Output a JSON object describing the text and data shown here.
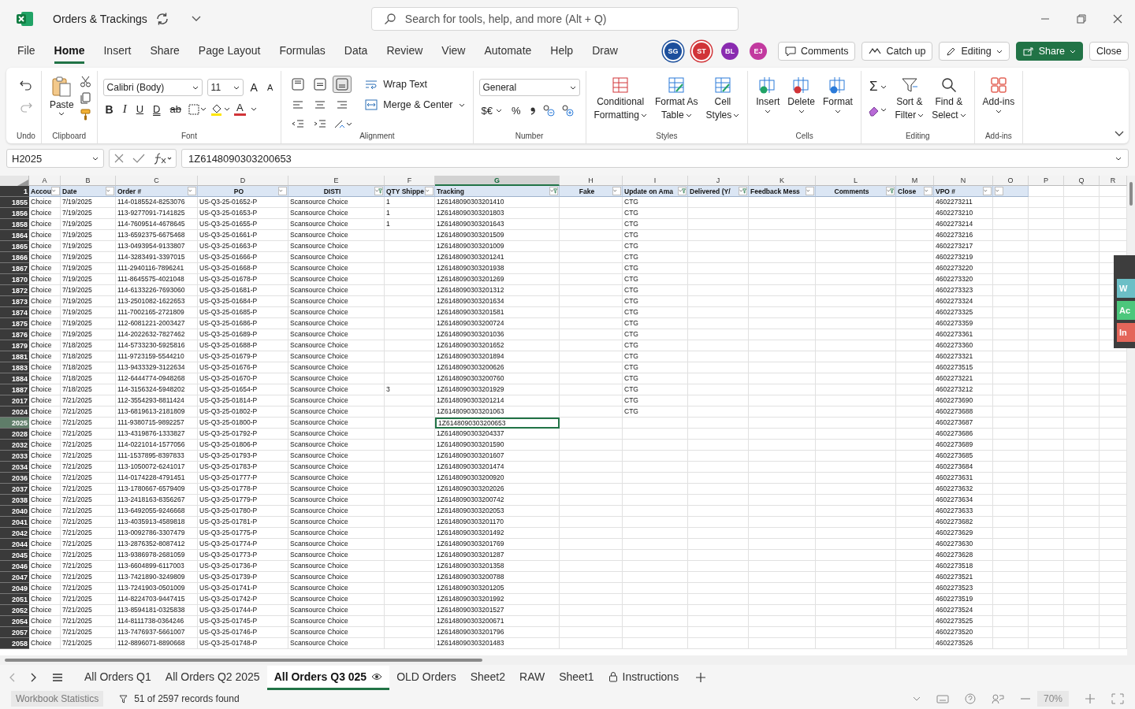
{
  "window": {
    "title": "Orders & Trackings"
  },
  "search": {
    "placeholder": "Search for tools, help, and more (Alt + Q)"
  },
  "menu": [
    {
      "label": "File",
      "selected": false
    },
    {
      "label": "Home",
      "selected": true
    },
    {
      "label": "Insert",
      "selected": false
    },
    {
      "label": "Share",
      "selected": false
    },
    {
      "label": "Page Layout",
      "selected": false
    },
    {
      "label": "Formulas",
      "selected": false
    },
    {
      "label": "Data",
      "selected": false
    },
    {
      "label": "Review",
      "selected": false
    },
    {
      "label": "View",
      "selected": false
    },
    {
      "label": "Automate",
      "selected": false
    },
    {
      "label": "Help",
      "selected": false
    },
    {
      "label": "Draw",
      "selected": false
    }
  ],
  "collaborators": [
    {
      "initials": "SG",
      "color": "#1c4f9c",
      "active": true
    },
    {
      "initials": "ST",
      "color": "#d13438",
      "active": true
    },
    {
      "initials": "BL",
      "color": "#8a2bb0",
      "active": false
    },
    {
      "initials": "EJ",
      "color": "#c2399f",
      "active": false
    }
  ],
  "actions": [
    {
      "label": "Comments",
      "kind": "comments"
    },
    {
      "label": "Catch up",
      "kind": "catchup"
    },
    {
      "label": "Editing",
      "kind": "editing"
    },
    {
      "label": "Share",
      "kind": "share"
    },
    {
      "label": "Close",
      "kind": "plain"
    }
  ],
  "ribbon": [
    {
      "kind": "undo",
      "label": "Undo"
    },
    {
      "kind": "clipboard",
      "label": "Clipboard",
      "paste": "Paste"
    },
    {
      "kind": "font",
      "label": "Font",
      "font": "Calibri (Body)",
      "size": "11",
      "grow": "A",
      "shrink": "A",
      "styles": [
        "B",
        "I",
        "U",
        "D",
        "ab"
      ],
      "color_button": "A"
    },
    {
      "kind": "alignment",
      "label": "Alignment",
      "wrap": "Wrap Text",
      "merge": "Merge & Center"
    },
    {
      "kind": "number",
      "label": "Number",
      "format": "General",
      "currency": "$€",
      "percent": "%"
    },
    {
      "kind": "styles",
      "label": "Styles",
      "buttons": [
        {
          "lines": [
            "Conditional",
            "Formatting"
          ]
        },
        {
          "lines": [
            "Format As",
            "Table"
          ]
        },
        {
          "lines": [
            "Cell",
            "Styles"
          ]
        }
      ]
    },
    {
      "kind": "cells",
      "label": "Cells",
      "buttons": [
        {
          "lines": [
            "Insert"
          ]
        },
        {
          "lines": [
            "Delete"
          ]
        },
        {
          "lines": [
            "Format"
          ]
        }
      ]
    },
    {
      "kind": "editing",
      "label": "Editing",
      "sum": "Σ",
      "buttons": [
        {
          "lines": [
            "Sort &",
            "Filter"
          ]
        },
        {
          "lines": [
            "Find &",
            "Select"
          ]
        }
      ]
    },
    {
      "kind": "addins",
      "label": "Add-ins",
      "buttons": [
        {
          "lines": [
            "Add-ins"
          ]
        }
      ]
    }
  ],
  "formula_bar": {
    "name_box": "H2025",
    "formula": "1Z6148090303200653"
  },
  "columns": [
    {
      "letter": "A",
      "selected": false,
      "header": {
        "text": "Accou",
        "filtered": false
      }
    },
    {
      "letter": "B",
      "selected": false,
      "header": {
        "text": "Date",
        "filtered": false
      }
    },
    {
      "letter": "C",
      "selected": false,
      "header": {
        "text": "Order #",
        "filtered": false
      }
    },
    {
      "letter": "D",
      "selected": false,
      "header": {
        "text": "PO",
        "filtered": false
      }
    },
    {
      "letter": "E",
      "selected": false,
      "header": {
        "text": "DISTI",
        "filtered": true
      }
    },
    {
      "letter": "F",
      "selected": false,
      "header": {
        "text": "QTY Shippe",
        "filtered": false
      }
    },
    {
      "letter": "G",
      "selected": true,
      "header": {
        "text": "Tracking",
        "filtered": true
      }
    },
    {
      "letter": "H",
      "selected": false,
      "header": {
        "text": "Fake",
        "filtered": false
      }
    },
    {
      "letter": "I",
      "selected": false,
      "header": {
        "text": "Update on Ama",
        "filtered": true
      }
    },
    {
      "letter": "J",
      "selected": false,
      "header": {
        "text": "Delivered (Y/",
        "filtered": true
      }
    },
    {
      "letter": "K",
      "selected": false,
      "header": {
        "text": "Feedback Mess",
        "filtered": false
      }
    },
    {
      "letter": "L",
      "selected": false,
      "header": {
        "text": "Comments",
        "filtered": true
      }
    },
    {
      "letter": "M",
      "selected": false,
      "header": {
        "text": "Close",
        "filtered": false
      }
    },
    {
      "letter": "N",
      "selected": false,
      "header": {
        "text": "VPO #",
        "filtered": false
      }
    },
    {
      "letter": "O",
      "selected": false,
      "header": {
        "filtered": false
      }
    },
    {
      "letter": "P",
      "selected": false
    },
    {
      "letter": "Q",
      "selected": false
    },
    {
      "letter": "R",
      "selected": false
    }
  ],
  "header_row_number": "1",
  "rows": [
    {
      "number": "1855",
      "selected": false,
      "account": "Choice",
      "date": "7/19/2025",
      "order": "114-0185524-8253076",
      "po": "US-Q3-25-01652-P",
      "disti": "Scansource Choice",
      "qty": "1",
      "tracking": "1Z6148090303201410",
      "update": "CTG",
      "vpo": "4602273211"
    },
    {
      "number": "1856",
      "selected": false,
      "account": "Choice",
      "date": "7/19/2025",
      "order": "113-9277091-7141825",
      "po": "US-Q3-25-01653-P",
      "disti": "Scansource Choice",
      "qty": "1",
      "tracking": "1Z6148090303201803",
      "update": "CTG",
      "vpo": "4602273210"
    },
    {
      "number": "1858",
      "selected": false,
      "account": "Choice",
      "date": "7/19/2025",
      "order": "114-7609514-4678645",
      "po": "US-Q3-25-01655-P",
      "disti": "Scansource Choice",
      "qty": "1",
      "tracking": "1Z6148090303201643",
      "update": "CTG",
      "vpo": "4602273214"
    },
    {
      "number": "1864",
      "selected": false,
      "account": "Choice",
      "date": "7/19/2025",
      "order": "113-6592375-6675468",
      "po": "US-Q3-25-01661-P",
      "disti": "Scansource Choice",
      "tracking": "1Z6148090303201509",
      "update": "CTG",
      "vpo": "4602273216"
    },
    {
      "number": "1865",
      "selected": false,
      "account": "Choice",
      "date": "7/19/2025",
      "order": "113-0493954-9133807",
      "po": "US-Q3-25-01663-P",
      "disti": "Scansource Choice",
      "tracking": "1Z6148090303201009",
      "update": "CTG",
      "vpo": "4602273217"
    },
    {
      "number": "1866",
      "selected": false,
      "account": "Choice",
      "date": "7/19/2025",
      "order": "114-3283491-3397015",
      "po": "US-Q3-25-01666-P",
      "disti": "Scansource Choice",
      "tracking": "1Z6148090303201241",
      "update": "CTG",
      "vpo": "4602273219"
    },
    {
      "number": "1867",
      "selected": false,
      "account": "Choice",
      "date": "7/19/2025",
      "order": "111-2940116-7896241",
      "po": "US-Q3-25-01668-P",
      "disti": "Scansource Choice",
      "tracking": "1Z6148090303201938",
      "update": "CTG",
      "vpo": "4602273220"
    },
    {
      "number": "1870",
      "selected": false,
      "account": "Choice",
      "date": "7/19/2025",
      "order": "111-8645575-4021048",
      "po": "US-Q3-25-01678-P",
      "disti": "Scansource Choice",
      "tracking": "1Z6148090303201269",
      "update": "CTG",
      "vpo": "4602273320"
    },
    {
      "number": "1872",
      "selected": false,
      "account": "Choice",
      "date": "7/19/2025",
      "order": "114-6133226-7693060",
      "po": "US-Q3-25-01681-P",
      "disti": "Scansource Choice",
      "tracking": "1Z6148090303201312",
      "update": "CTG",
      "vpo": "4602273323"
    },
    {
      "number": "1873",
      "selected": false,
      "account": "Choice",
      "date": "7/19/2025",
      "order": "113-2501082-1622653",
      "po": "US-Q3-25-01684-P",
      "disti": "Scansource Choice",
      "tracking": "1Z6148090303201634",
      "update": "CTG",
      "vpo": "4602273324"
    },
    {
      "number": "1874",
      "selected": false,
      "account": "Choice",
      "date": "7/19/2025",
      "order": "111-7002165-2721809",
      "po": "US-Q3-25-01685-P",
      "disti": "Scansource Choice",
      "tracking": "1Z6148090303201581",
      "update": "CTG",
      "vpo": "4602273325"
    },
    {
      "number": "1875",
      "selected": false,
      "account": "Choice",
      "date": "7/19/2025",
      "order": "112-6081221-2003427",
      "po": "US-Q3-25-01686-P",
      "disti": "Scansource Choice",
      "tracking": "1Z6148090303200724",
      "update": "CTG",
      "vpo": "4602273359"
    },
    {
      "number": "1876",
      "selected": false,
      "account": "Choice",
      "date": "7/19/2025",
      "order": "114-2022632-7827462",
      "po": "US-Q3-25-01689-P",
      "disti": "Scansource Choice",
      "tracking": "1Z6148090303201036",
      "update": "CTG",
      "vpo": "4602273361"
    },
    {
      "number": "1879",
      "selected": false,
      "account": "Choice",
      "date": "7/18/2025",
      "order": "114-5733230-5925816",
      "po": "US-Q3-25-01688-P",
      "disti": "Scansource Choice",
      "tracking": "1Z6148090303201652",
      "update": "CTG",
      "vpo": "4602273360"
    },
    {
      "number": "1881",
      "selected": false,
      "account": "Choice",
      "date": "7/18/2025",
      "order": "111-9723159-5544210",
      "po": "US-Q3-25-01679-P",
      "disti": "Scansource Choice",
      "tracking": "1Z6148090303201894",
      "update": "CTG",
      "vpo": "4602273321"
    },
    {
      "number": "1883",
      "selected": false,
      "account": "Choice",
      "date": "7/18/2025",
      "order": "113-9433329-3122634",
      "po": "US-Q3-25-01676-P",
      "disti": "Scansource Choice",
      "tracking": "1Z6148090303200626",
      "update": "CTG",
      "vpo": "4602273515"
    },
    {
      "number": "1884",
      "selected": false,
      "account": "Choice",
      "date": "7/18/2025",
      "order": "112-6444774-0948268",
      "po": "US-Q3-25-01670-P",
      "disti": "Scansource Choice",
      "tracking": "1Z6148090303200760",
      "update": "CTG",
      "vpo": "4602273221"
    },
    {
      "number": "1887",
      "selected": false,
      "account": "Choice",
      "date": "7/18/2025",
      "order": "114-3156324-5948202",
      "po": "US-Q3-25-01654-P",
      "disti": "Scansource Choice",
      "qty": "3",
      "tracking": "1Z6148090303201929",
      "update": "CTG",
      "vpo": "4602273212"
    },
    {
      "number": "2017",
      "selected": false,
      "account": "Choice",
      "date": "7/21/2025",
      "order": "112-3554293-8811424",
      "po": "US-Q3-25-01814-P",
      "disti": "Scansource Choice",
      "tracking": "1Z6148090303201214",
      "update": "CTG",
      "vpo": "4602273690"
    },
    {
      "number": "2024",
      "selected": false,
      "account": "Choice",
      "date": "7/21/2025",
      "order": "113-6819613-2181809",
      "po": "US-Q3-25-01802-P",
      "disti": "Scansource Choice",
      "tracking": "1Z6148090303201063",
      "update": "CTG",
      "vpo": "4602273688"
    },
    {
      "number": "2025",
      "selected": true,
      "account": "Choice",
      "date": "7/21/2025",
      "order": "111-9380715-9892257",
      "po": "US-Q3-25-01800-P",
      "disti": "Scansource Choice",
      "tracking": "1Z6148090303200653",
      "vpo": "4602273687"
    },
    {
      "number": "2028",
      "selected": false,
      "account": "Choice",
      "date": "7/21/2025",
      "order": "113-4319876-1333827",
      "po": "US-Q3-25-01792-P",
      "disti": "Scansource Choice",
      "tracking": "1Z6148090303204337",
      "vpo": "4602273686"
    },
    {
      "number": "2032",
      "selected": false,
      "account": "Choice",
      "date": "7/21/2025",
      "order": "114-0221014-1577056",
      "po": "US-Q3-25-01806-P",
      "disti": "Scansource Choice",
      "tracking": "1Z6148090303201590",
      "vpo": "4602273689"
    },
    {
      "number": "2033",
      "selected": false,
      "account": "Choice",
      "date": "7/21/2025",
      "order": "111-1537895-8397833",
      "po": "US-Q3-25-01793-P",
      "disti": "Scansource Choice",
      "tracking": "1Z6148090303201607",
      "vpo": "4602273685"
    },
    {
      "number": "2034",
      "selected": false,
      "account": "Choice",
      "date": "7/21/2025",
      "order": "113-1050072-6241017",
      "po": "US-Q3-25-01783-P",
      "disti": "Scansource Choice",
      "tracking": "1Z6148090303201474",
      "vpo": "4602273684"
    },
    {
      "number": "2036",
      "selected": false,
      "account": "Choice",
      "date": "7/21/2025",
      "order": "114-0174228-4791451",
      "po": "US-Q3-25-01777-P",
      "disti": "Scansource Choice",
      "tracking": "1Z6148090303200920",
      "vpo": "4602273631"
    },
    {
      "number": "2037",
      "selected": false,
      "account": "Choice",
      "date": "7/21/2025",
      "order": "113-1780667-6579409",
      "po": "US-Q3-25-01778-P",
      "disti": "Scansource Choice",
      "tracking": "1Z6148090303202026",
      "vpo": "4602273632"
    },
    {
      "number": "2038",
      "selected": false,
      "account": "Choice",
      "date": "7/21/2025",
      "order": "113-2418163-8356267",
      "po": "US-Q3-25-01779-P",
      "disti": "Scansource Choice",
      "tracking": "1Z6148090303200742",
      "vpo": "4602273634"
    },
    {
      "number": "2040",
      "selected": false,
      "account": "Choice",
      "date": "7/21/2025",
      "order": "113-6492055-9246668",
      "po": "US-Q3-25-01780-P",
      "disti": "Scansource Choice",
      "tracking": "1Z6148090303202053",
      "vpo": "4602273633"
    },
    {
      "number": "2041",
      "selected": false,
      "account": "Choice",
      "date": "7/21/2025",
      "order": "113-4035913-4589818",
      "po": "US-Q3-25-01781-P",
      "disti": "Scansource Choice",
      "tracking": "1Z6148090303201170",
      "vpo": "4602273682"
    },
    {
      "number": "2042",
      "selected": false,
      "account": "Choice",
      "date": "7/21/2025",
      "order": "113-0092786-3307479",
      "po": "US-Q3-25-01775-P",
      "disti": "Scansource Choice",
      "tracking": "1Z6148090303201492",
      "vpo": "4602273629"
    },
    {
      "number": "2044",
      "selected": false,
      "account": "Choice",
      "date": "7/21/2025",
      "order": "113-2876352-8087412",
      "po": "US-Q3-25-01774-P",
      "disti": "Scansource Choice",
      "tracking": "1Z6148090303201769",
      "vpo": "4602273630"
    },
    {
      "number": "2045",
      "selected": false,
      "account": "Choice",
      "date": "7/21/2025",
      "order": "113-9386978-2681059",
      "po": "US-Q3-25-01773-P",
      "disti": "Scansource Choice",
      "tracking": "1Z6148090303201287",
      "vpo": "4602273628"
    },
    {
      "number": "2046",
      "selected": false,
      "account": "Choice",
      "date": "7/21/2025",
      "order": "113-6604899-6117003",
      "po": "US-Q3-25-01736-P",
      "disti": "Scansource Choice",
      "tracking": "1Z6148090303201358",
      "vpo": "4602273518"
    },
    {
      "number": "2047",
      "selected": false,
      "account": "Choice",
      "date": "7/21/2025",
      "order": "113-7421890-3249809",
      "po": "US-Q3-25-01739-P",
      "disti": "Scansource Choice",
      "tracking": "1Z6148090303200788",
      "vpo": "4602273521"
    },
    {
      "number": "2049",
      "selected": false,
      "account": "Choice",
      "date": "7/21/2025",
      "order": "113-7241903-0501009",
      "po": "US-Q3-25-01741-P",
      "disti": "Scansource Choice",
      "tracking": "1Z6148090303201205",
      "vpo": "4602273523"
    },
    {
      "number": "2051",
      "selected": false,
      "account": "Choice",
      "date": "7/21/2025",
      "order": "114-8224703-9447415",
      "po": "US-Q3-25-01742-P",
      "disti": "Scansource Choice",
      "tracking": "1Z6148090303201992",
      "vpo": "4602273519"
    },
    {
      "number": "2052",
      "selected": false,
      "account": "Choice",
      "date": "7/21/2025",
      "order": "113-8594181-0325838",
      "po": "US-Q3-25-01744-P",
      "disti": "Scansource Choice",
      "tracking": "1Z6148090303201527",
      "vpo": "4602273524"
    },
    {
      "number": "2054",
      "selected": false,
      "account": "Choice",
      "date": "7/21/2025",
      "order": "114-8111738-0364246",
      "po": "US-Q3-25-01745-P",
      "disti": "Scansource Choice",
      "tracking": "1Z6148090303200671",
      "vpo": "4602273525"
    },
    {
      "number": "2057",
      "selected": false,
      "account": "Choice",
      "date": "7/21/2025",
      "order": "113-7476937-5661007",
      "po": "US-Q3-25-01746-P",
      "disti": "Scansource Choice",
      "tracking": "1Z6148090303201796",
      "vpo": "4602273520"
    },
    {
      "number": "2058",
      "selected": false,
      "account": "Choice",
      "date": "7/21/2025",
      "order": "112-8896071-8890668",
      "po": "US-Q3-25-01748-P",
      "disti": "Scansource Choice",
      "tracking": "1Z6148090303201483",
      "vpo": "4602273526"
    }
  ],
  "side_panel": [
    {
      "label": "W",
      "color": "#6cbfc6"
    },
    {
      "label": "Ac",
      "color": "#4cc77c"
    },
    {
      "label": "In",
      "color": "#e4665a"
    }
  ],
  "sheet_tabs": [
    {
      "label": "All Orders Q1",
      "selected": false,
      "kind": "plain"
    },
    {
      "label": "All Orders Q2 2025",
      "selected": false,
      "kind": "plain"
    },
    {
      "label": "All Orders Q3 025",
      "selected": true,
      "kind": "watched"
    },
    {
      "label": "OLD Orders",
      "selected": false,
      "kind": "plain"
    },
    {
      "label": "Sheet2",
      "selected": false,
      "kind": "plain"
    },
    {
      "label": "RAW",
      "selected": false,
      "kind": "plain"
    },
    {
      "label": "Sheet1",
      "selected": false,
      "kind": "plain"
    },
    {
      "label": "Instructions",
      "selected": false,
      "kind": "locked"
    }
  ],
  "status_bar": {
    "workbook_statistics": "Workbook Statistics",
    "records": "51 of 2597 records found",
    "zoom": "70%"
  }
}
